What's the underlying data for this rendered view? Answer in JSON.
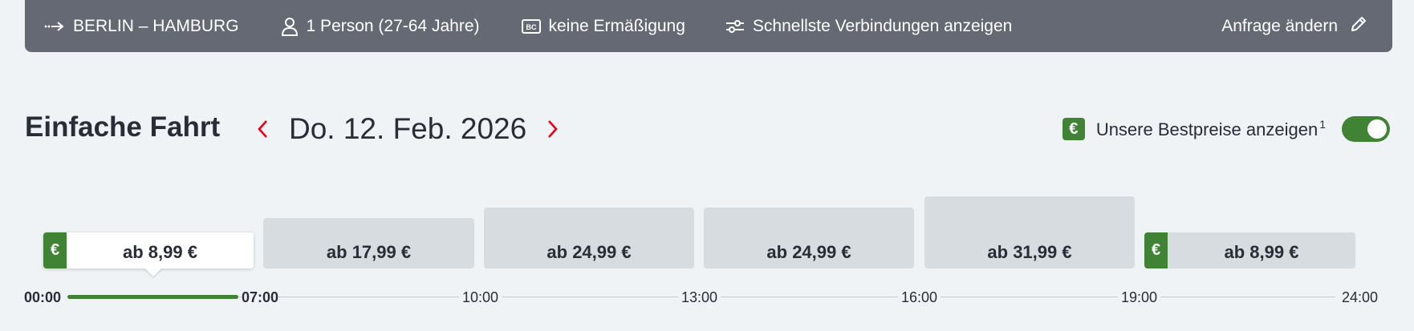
{
  "summary": {
    "route": "BERLIN – HAMBURG",
    "passengers": "1 Person (27-64 Jahre)",
    "discount_badge": "BC",
    "discount": "keine Ermäßigung",
    "filter": "Schnellste Verbindungen anzeigen",
    "edit_label": "Anfrage ändern",
    "icons": [
      "route-arrow-icon",
      "person-icon",
      "bahncard-icon",
      "sliders-icon",
      "pencil-icon"
    ]
  },
  "header": {
    "trip_type": "Einfache Fahrt",
    "date": "Do. 12. Feb. 2026"
  },
  "bestprice": {
    "badge": "€",
    "label": "Unsere Bestpreise anzeigen",
    "footnote": "1",
    "enabled": true
  },
  "slots": [
    {
      "price": "ab 8,99 €",
      "best": true,
      "selected": true,
      "badge": "€"
    },
    {
      "price": "ab 17,99 €",
      "best": false,
      "selected": false
    },
    {
      "price": "ab 24,99 €",
      "best": false,
      "selected": false
    },
    {
      "price": "ab 24,99 €",
      "best": false,
      "selected": false
    },
    {
      "price": "ab 31,99 €",
      "best": false,
      "selected": false
    },
    {
      "price": "ab 8,99 €",
      "best": true,
      "selected": false,
      "badge": "€"
    }
  ],
  "timeline": {
    "ticks": [
      "00:00",
      "07:00",
      "10:00",
      "13:00",
      "16:00",
      "19:00",
      "24:00"
    ],
    "active_range": [
      "00:00",
      "07:00"
    ]
  },
  "colors": {
    "summary_bg": "#646973",
    "page_bg": "#f0f3f5",
    "accent_green": "#408335",
    "nav_red": "#ec0016",
    "slot_bg": "#d7dce1",
    "text": "#282d37"
  }
}
